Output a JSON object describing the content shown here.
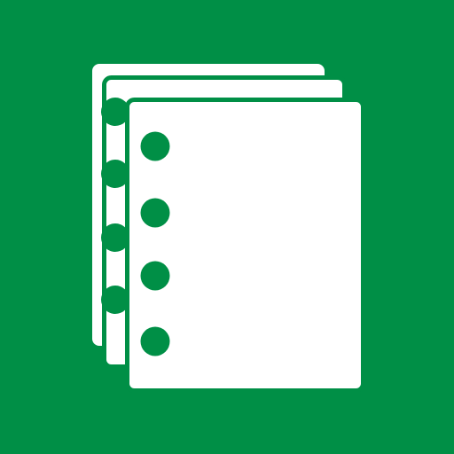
{
  "tile": {
    "icon": "notebooks-stack-icon",
    "background_color": "#008f46",
    "foreground_color": "#ffffff"
  }
}
